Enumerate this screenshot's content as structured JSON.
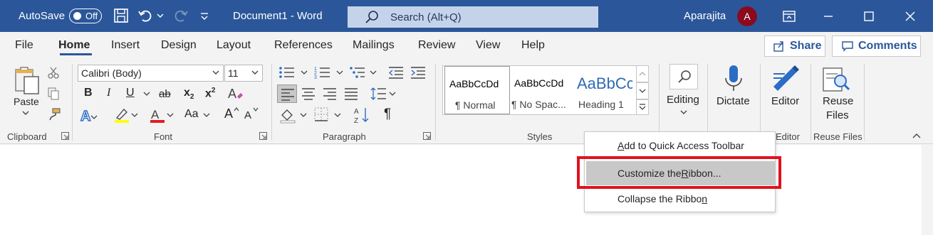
{
  "titlebar": {
    "autosave_label": "AutoSave",
    "autosave_state": "Off",
    "document_title": "Document1  -  Word",
    "search_placeholder": "Search (Alt+Q)",
    "user_name": "Aparajita",
    "avatar_initial": "A",
    "bg_color": "#2b579a"
  },
  "tabs": [
    "File",
    "Home",
    "Insert",
    "Design",
    "Layout",
    "References",
    "Mailings",
    "Review",
    "View",
    "Help"
  ],
  "active_tab": "Home",
  "share_label": "Share",
  "comments_label": "Comments",
  "clipboard": {
    "paste_label": "Paste",
    "group_label": "Clipboard"
  },
  "font": {
    "font_name": "Calibri (Body)",
    "font_size": "11",
    "group_label": "Font",
    "bold": "B",
    "italic": "I",
    "underline": "U",
    "strike": "ab",
    "subscript": "x",
    "superscript": "x",
    "sub_mark": "2",
    "sup_mark": "2",
    "case": "Aa",
    "grow": "A",
    "shrink": "A",
    "clear_fmt": "A",
    "text_effects": "A",
    "font_color": "A"
  },
  "paragraph": {
    "group_label": "Paragraph",
    "pilcrow": "¶"
  },
  "styles": {
    "group_label": "Styles",
    "items": [
      {
        "sample": "AaBbCcDd",
        "name": "¶ Normal"
      },
      {
        "sample": "AaBbCcDd",
        "name": "¶ No Spac..."
      },
      {
        "sample": "AaBbCc",
        "name": "Heading 1"
      }
    ]
  },
  "editing_label": "Editing",
  "dictate_label": "Dictate",
  "editor": {
    "label": "Editor",
    "group_label": "Editor"
  },
  "reuse": {
    "label_line1": "Reuse",
    "label_line2": "Files",
    "group_label": "Reuse Files"
  },
  "context_menu": {
    "items": [
      {
        "pre": "",
        "key": "A",
        "post": "dd to Quick Access Toolbar"
      },
      {
        "pre": "Customize the ",
        "key": "R",
        "post": "ibbon..."
      },
      {
        "pre": "Collapse the Ribbo",
        "key": "n",
        "post": ""
      }
    ]
  },
  "highlight_color": "#e0121e"
}
